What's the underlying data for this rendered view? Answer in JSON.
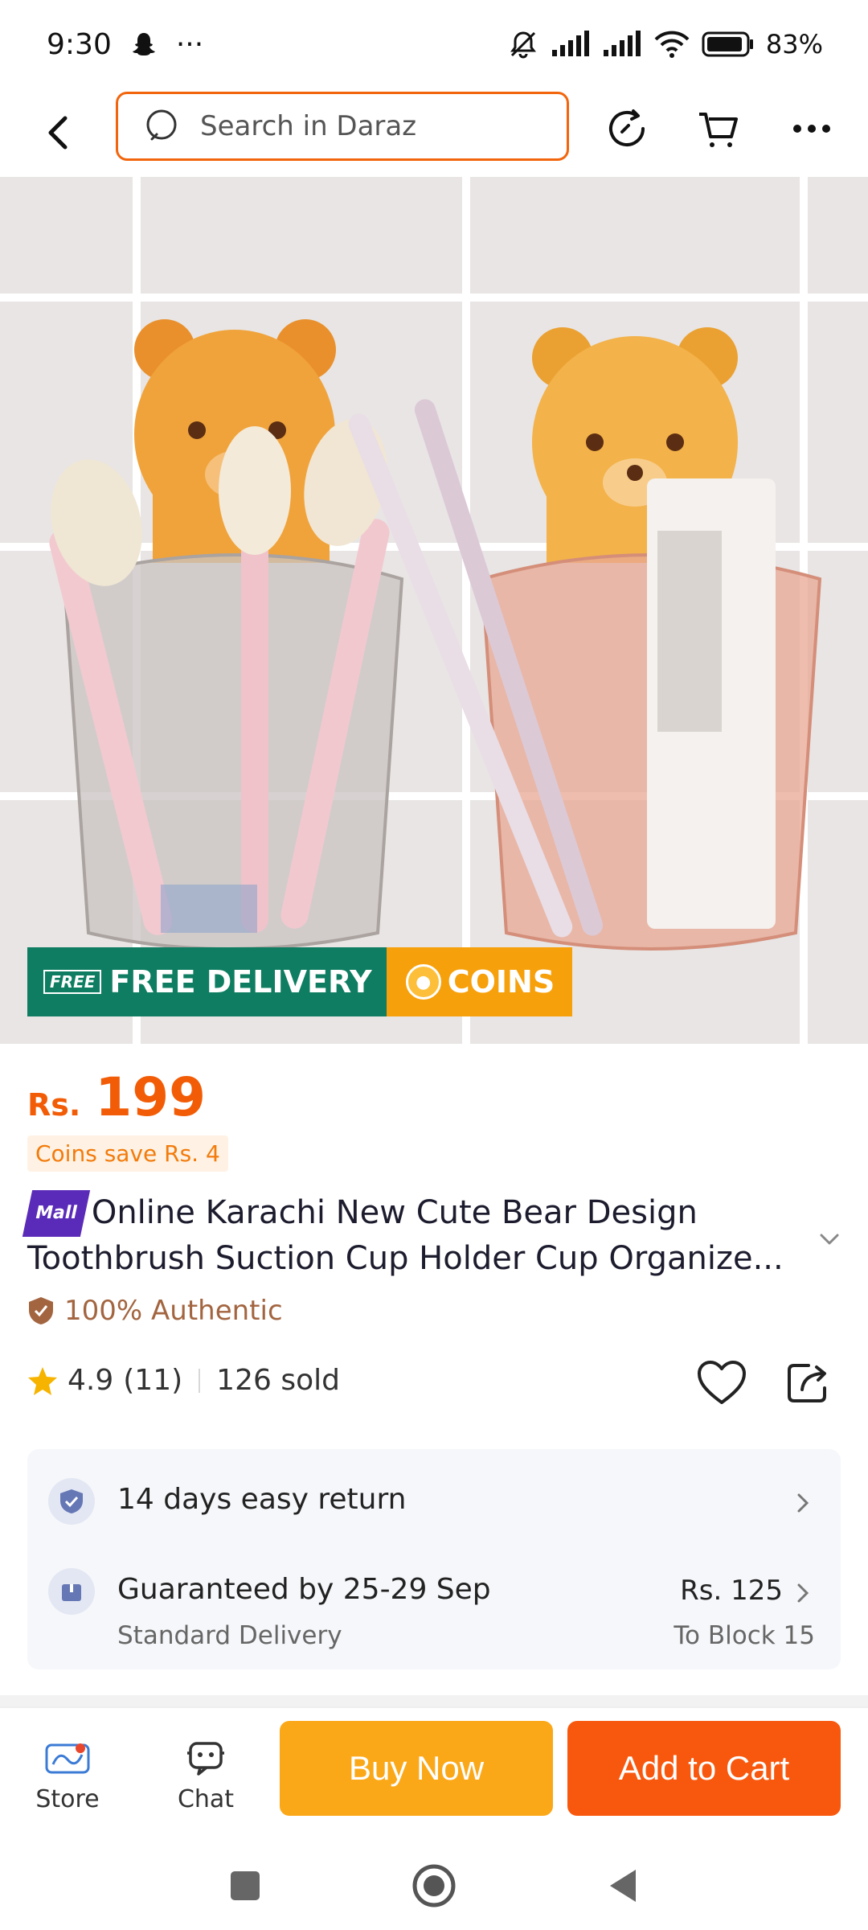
{
  "status_bar": {
    "time": "9:30",
    "more": "···",
    "battery": "83%"
  },
  "nav": {
    "search_placeholder": "Search in Daraz"
  },
  "promo": {
    "free_tag": "FREE",
    "free_delivery": "FREE DELIVERY",
    "coins": "COINS"
  },
  "price": {
    "currency": "Rs.",
    "amount": "199",
    "coins_save": "Coins save Rs. 4"
  },
  "product": {
    "mall_badge": "Mall",
    "title": "Online Karachi New Cute Bear Design Toothbrush Suction Cup Holder Cup Organize...",
    "authentic": "100% Authentic",
    "rating": "4.9",
    "rating_count": "(11)",
    "sold": "126 sold"
  },
  "services": {
    "return_label": "14 days easy return",
    "delivery_label": "Guaranteed by 25-29 Sep",
    "delivery_type": "Standard Delivery",
    "delivery_price": "Rs. 125",
    "delivery_location": "To Block 15"
  },
  "action_bar": {
    "store_label": "Store",
    "chat_label": "Chat",
    "buy_now": "Buy Now",
    "add_to_cart": "Add to Cart"
  },
  "colors": {
    "accent_orange": "#f8580e",
    "buy_now_yellow": "#fba818",
    "free_delivery_green": "#0e7d61",
    "price_orange": "#f25c06"
  }
}
